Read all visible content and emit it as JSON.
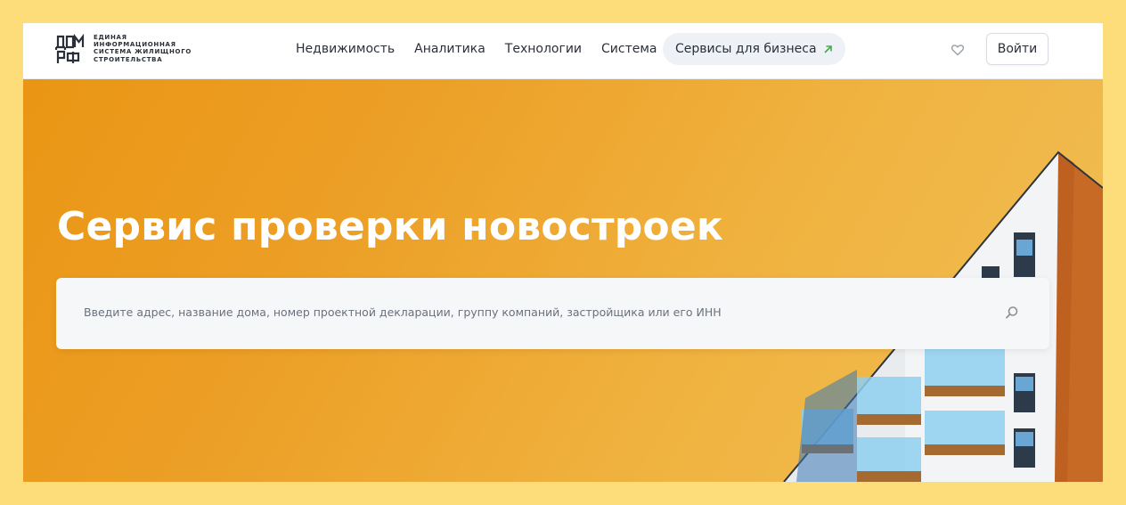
{
  "logo": {
    "mark": "ДОМ РФ",
    "lines": [
      "ЕДИНАЯ",
      "ИНФОРМАЦИОННАЯ",
      "СИСТЕМА ЖИЛИЩНОГО",
      "СТРОИТЕЛЬСТВА"
    ]
  },
  "nav": {
    "items": [
      "Недвижимость",
      "Аналитика",
      "Технологии",
      "Система"
    ]
  },
  "business_button": {
    "label": "Сервисы для бизнеса",
    "arrow_icon": "arrow-up-right-icon",
    "arrow_color": "#3fae49"
  },
  "favorites_icon": "heart-icon",
  "login_button": {
    "label": "Войти"
  },
  "hero": {
    "title": "Сервис проверки новостроек",
    "search_placeholder": "Введите адрес, название дома, номер проектной декларации, группу компаний, застройщика или его ИНН",
    "search_icon": "search-icon"
  },
  "colors": {
    "frame_background": "#fddc7a",
    "hero_gradient_start": "#ea9614",
    "hero_gradient_end": "#f1be55",
    "header_background": "#ffffff"
  }
}
